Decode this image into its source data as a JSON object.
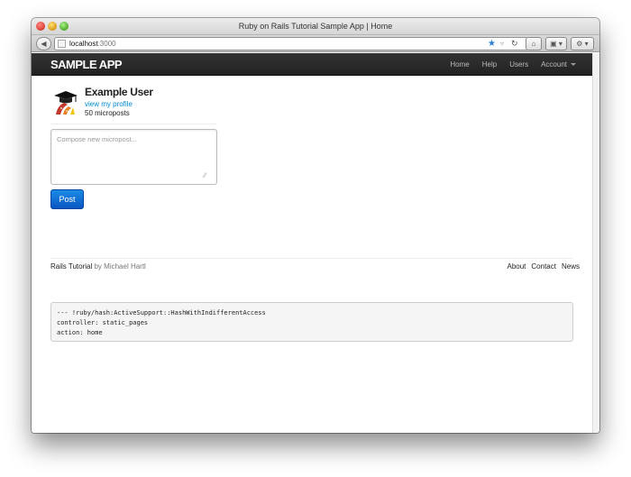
{
  "window": {
    "title": "Ruby on Rails Tutorial Sample App | Home"
  },
  "toolbar": {
    "url_host": "localhost",
    "url_port": ":3000",
    "icons": [
      "back-arrow-icon",
      "favicon-icon",
      "bookmark-star-icon",
      "rss-icon",
      "reload-icon",
      "home-icon",
      "sidebar-icon",
      "tools-icon"
    ]
  },
  "navbar": {
    "brand": "SAMPLE APP",
    "links": [
      "Home",
      "Help",
      "Users",
      "Account"
    ]
  },
  "user": {
    "name": "Example User",
    "profile_link": "view my profile",
    "microposts": "50 microposts"
  },
  "compose": {
    "placeholder": "Compose new micropost..."
  },
  "post_button": "Post",
  "footer": {
    "brand": "Rails Tutorial",
    "by": "by Michael Hartl",
    "links": [
      "About",
      "Contact",
      "News"
    ]
  },
  "debug": {
    "lines": [
      "--- !ruby/hash:ActiveSupport::HashWithIndifferentAccess",
      "controller: static_pages",
      "action: home"
    ]
  },
  "colors": {
    "navbar": "#222222",
    "link": "#0088cc",
    "button": "#0a55c2"
  }
}
